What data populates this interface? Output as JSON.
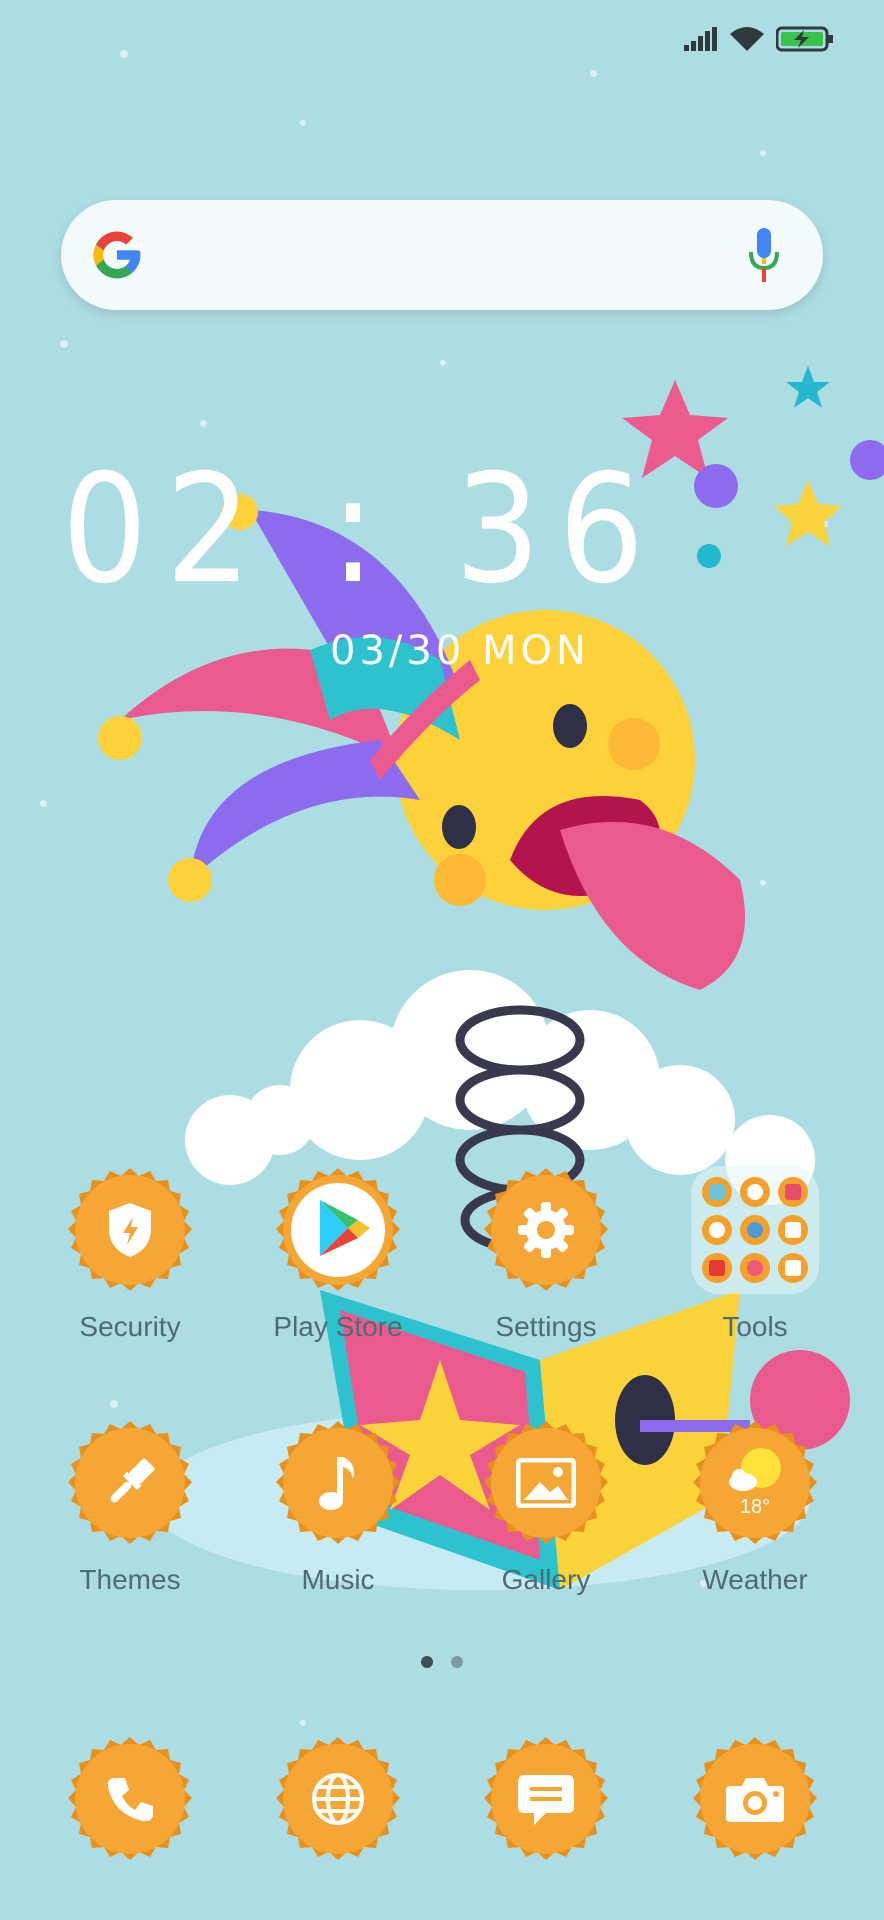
{
  "status_bar": {
    "signal": "signal-icon",
    "wifi": "wifi-icon",
    "battery": "battery-charging-icon"
  },
  "search": {
    "logo": "google-logo",
    "mic": "mic-icon"
  },
  "clock": {
    "time": "02 : 36",
    "date": "03/30  MON"
  },
  "apps_row1": [
    {
      "label": "Security",
      "icon": "shield-icon"
    },
    {
      "label": "Play Store",
      "icon": "play-store-icon"
    },
    {
      "label": "Settings",
      "icon": "gear-icon"
    },
    {
      "label": "Tools",
      "icon": "folder-icon"
    }
  ],
  "apps_row2": [
    {
      "label": "Themes",
      "icon": "brush-icon"
    },
    {
      "label": "Music",
      "icon": "music-note-icon"
    },
    {
      "label": "Gallery",
      "icon": "image-icon"
    },
    {
      "label": "Weather",
      "icon": "weather-icon",
      "temp": "18°"
    }
  ],
  "dock": [
    {
      "icon": "phone-icon"
    },
    {
      "icon": "globe-icon"
    },
    {
      "icon": "message-icon"
    },
    {
      "icon": "camera-icon"
    }
  ],
  "page_indicator": {
    "pages": 2,
    "current": 1
  },
  "colors": {
    "background": "#acdde3",
    "badge": "#f4a02a",
    "badge_edge": "#e8901c"
  }
}
